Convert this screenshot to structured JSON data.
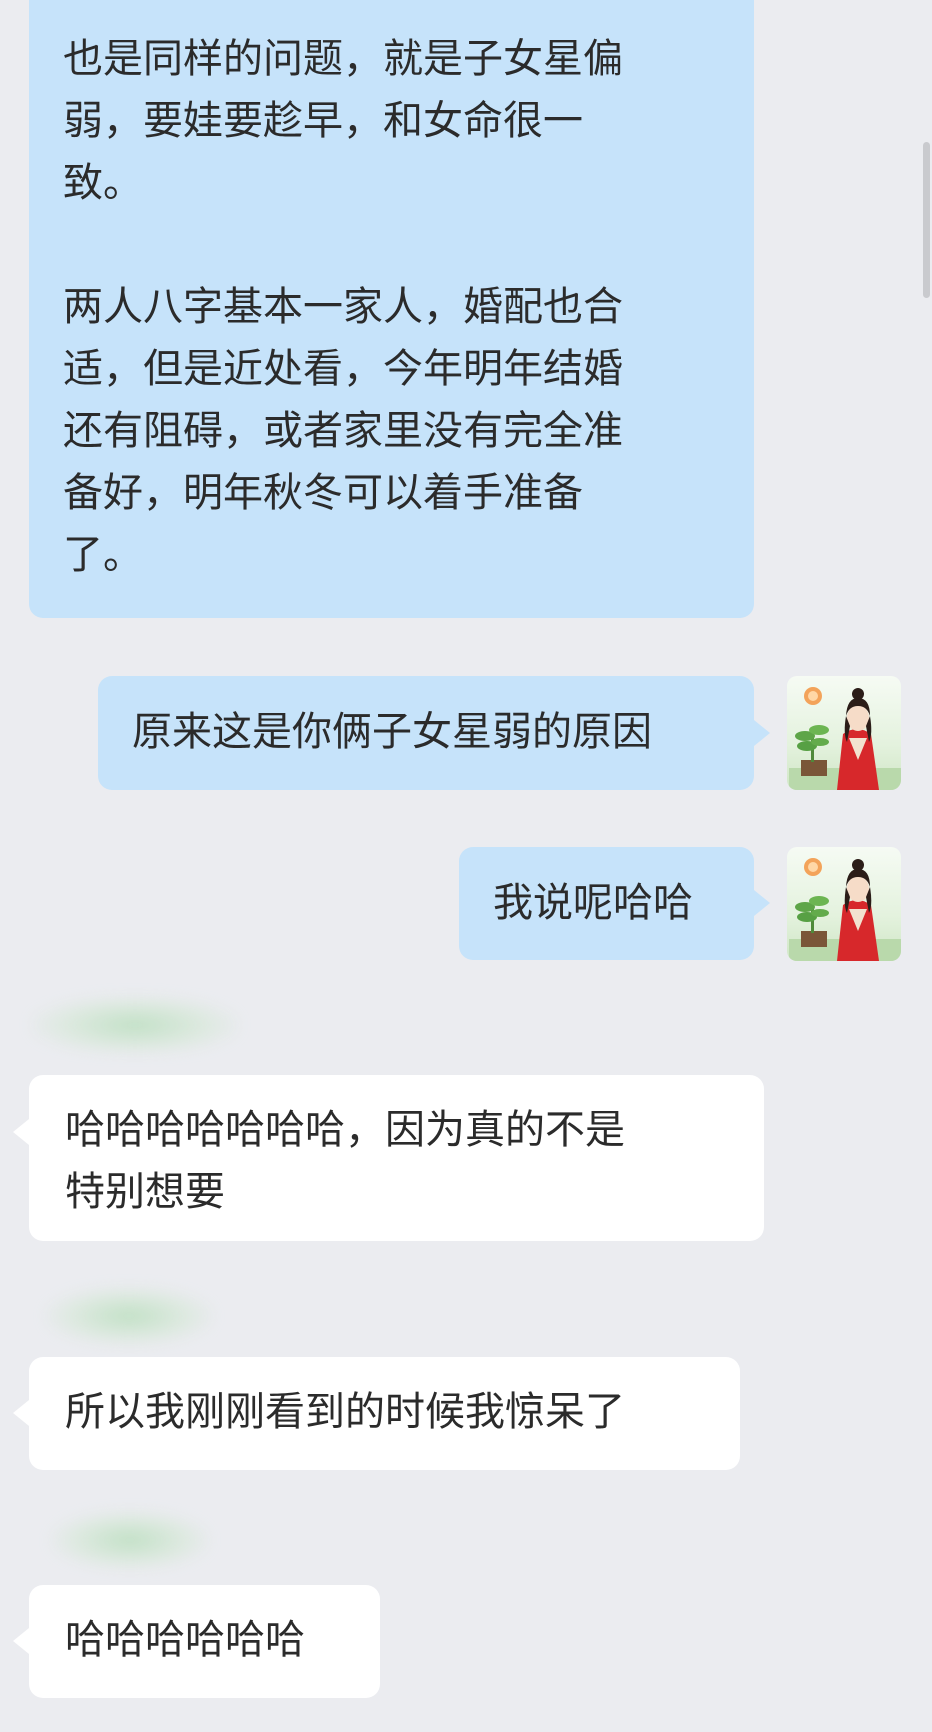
{
  "messages": [
    {
      "side": "sent",
      "text": "也是同样的问题，就是子女星偏\n弱，要娃要趁早，和女命很一\n致。\n\n两人八字基本一家人，婚配也合\n适，但是近处看，今年明年结婚\n还有阻碍，或者家里没有完全准\n备好，明年秋冬可以着手准备\n了。"
    },
    {
      "side": "sent",
      "text": "原来这是你俩子女星弱的原因"
    },
    {
      "side": "sent",
      "text": "我说呢哈哈"
    },
    {
      "side": "received",
      "text": "哈哈哈哈哈哈哈，因为真的不是\n特别想要"
    },
    {
      "side": "received",
      "text": "所以我刚刚看到的时候我惊呆了"
    },
    {
      "side": "received",
      "text": "哈哈哈哈哈哈"
    }
  ],
  "colors": {
    "background": "#ebecf0",
    "sent_bubble": "#c6e3fa",
    "received_bubble": "#ffffff"
  },
  "icons": {
    "avatar": "avatar-woman-in-red-hanfu-icon"
  }
}
